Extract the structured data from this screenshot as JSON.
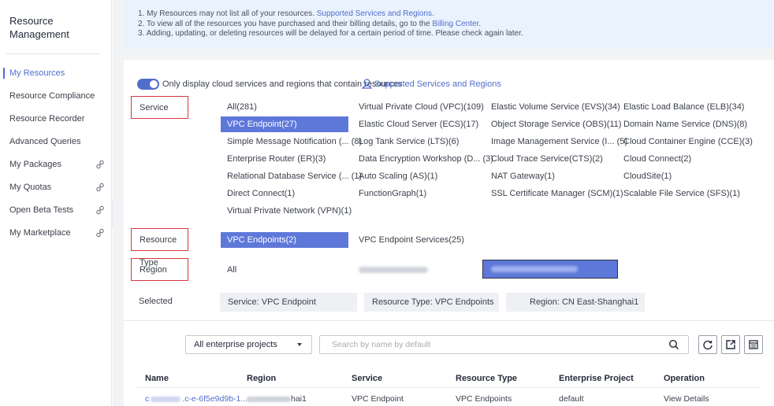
{
  "sidebar": {
    "title": "Resource Management",
    "items": [
      {
        "label": "My Resources",
        "active": true,
        "link": false
      },
      {
        "label": "Resource Compliance",
        "active": false,
        "link": false
      },
      {
        "label": "Resource Recorder",
        "active": false,
        "link": false
      },
      {
        "label": "Advanced Queries",
        "active": false,
        "link": false
      },
      {
        "label": "My Packages",
        "active": false,
        "link": true
      },
      {
        "label": "My Quotas",
        "active": false,
        "link": true
      },
      {
        "label": "Open Beta Tests",
        "active": false,
        "link": true
      },
      {
        "label": "My Marketplace",
        "active": false,
        "link": true
      }
    ]
  },
  "notice": {
    "line1_prefix": "1. My Resources may not list all of your resources.",
    "line1_link": "Supported Services and Regions.",
    "line2_prefix": "2. To view all of the resources you have purchased and their billing details, go to the",
    "line2_link": "Billing Center",
    "line2_suffix": ".",
    "line3": "3. Adding, updating, or deleting resources will be delayed for a certain period of time. Please check again later."
  },
  "toggle": {
    "label": "Only display cloud services and regions that contain resources",
    "link": "Supported Services and Regions",
    "on": true
  },
  "filters": {
    "service_label": "Service",
    "services": [
      [
        "All(281)",
        "Virtual Private Cloud (VPC)(109)",
        "Elastic Volume Service (EVS)(34)",
        "Elastic Load Balance (ELB)(34)"
      ],
      [
        "VPC Endpoint(27)",
        "Elastic Cloud Server (ECS)(17)",
        "Object Storage Service (OBS)(11)",
        "Domain Name Service (DNS)(8)"
      ],
      [
        "Simple Message Notification (... (8)",
        "Log Tank Service (LTS)(6)",
        "Image Management Service (I... (5)",
        "Cloud Container Engine (CCE)(3)"
      ],
      [
        "Enterprise Router (ER)(3)",
        "Data Encryption Workshop (D... (3)",
        "Cloud Trace Service(CTS)(2)",
        "Cloud Connect(2)"
      ],
      [
        "Relational Database Service (... (1)",
        "Auto Scaling (AS)(1)",
        "NAT Gateway(1)",
        "CloudSite(1)"
      ],
      [
        "Direct Connect(1)",
        "FunctionGraph(1)",
        "SSL Certificate Manager (SCM)(1)",
        "Scalable File Service (SFS)(1)"
      ],
      [
        "Virtual Private Network (VPN)(1)"
      ]
    ],
    "selected_service": "VPC Endpoint(27)",
    "resource_type_label": "Resource Type",
    "resource_types": [
      "VPC Endpoints(2)",
      "VPC Endpoint Services(25)"
    ],
    "region_label": "Region",
    "region_all": "All",
    "selected_label": "Selected",
    "chips": [
      "Service: VPC Endpoint",
      "Resource Type: VPC Endpoints",
      "Region: CN East-Shanghai1"
    ]
  },
  "toolbar": {
    "project_select": "All enterprise projects",
    "search_placeholder": "Search by name by default"
  },
  "table": {
    "headers": [
      "Name",
      "Region",
      "Service",
      "Resource Type",
      "Enterprise Project",
      "Operation"
    ],
    "rows": [
      {
        "name_prefix": "c",
        "name_suffix": ".c-e-6f5e9d9b-1....",
        "region_suffix": "hai1",
        "service": "VPC Endpoint",
        "resource_type": "VPC Endpoints",
        "project": "default",
        "operation": "View Details"
      }
    ]
  },
  "colors": {
    "accent": "#526ecc",
    "selected_bg": "#5e78d9",
    "highlight_box": "#d9363e"
  }
}
